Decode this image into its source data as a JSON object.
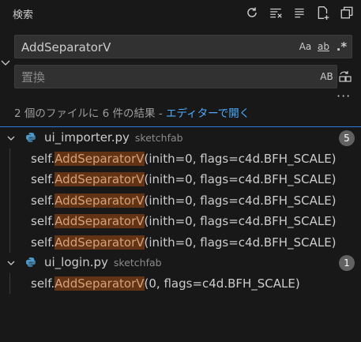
{
  "panel": {
    "title": "検索"
  },
  "header_actions": [
    {
      "name": "refresh-icon"
    },
    {
      "name": "clear-results-icon"
    },
    {
      "name": "collapse-all-icon"
    },
    {
      "name": "new-search-editor-icon"
    },
    {
      "name": "view-as-tree-icon"
    }
  ],
  "search": {
    "value": "AddSeparatorV",
    "options": {
      "match_case": "Aa",
      "whole_word": "ab",
      "regex": ".*"
    }
  },
  "replace": {
    "placeholder": "置換",
    "preserve_case": "AB"
  },
  "summary": {
    "text": "2 個のファイルに 6 件の結果 - ",
    "link": "エディターで開く"
  },
  "results": [
    {
      "file": "ui_importer.py",
      "path": "sketchfab",
      "count": "5",
      "matches": [
        {
          "before": "self.",
          "match": "AddSeparatorV",
          "after": "(inith=0, flags=c4d.BFH_SCALE)"
        },
        {
          "before": "self.",
          "match": "AddSeparatorV",
          "after": "(inith=0, flags=c4d.BFH_SCALE)"
        },
        {
          "before": "self.",
          "match": "AddSeparatorV",
          "after": "(inith=0, flags=c4d.BFH_SCALE)"
        },
        {
          "before": "self.",
          "match": "AddSeparatorV",
          "after": "(inith=0, flags=c4d.BFH_SCALE)"
        },
        {
          "before": "self.",
          "match": "AddSeparatorV",
          "after": "(inith=0, flags=c4d.BFH_SCALE)"
        }
      ]
    },
    {
      "file": "ui_login.py",
      "path": "sketchfab",
      "count": "1",
      "matches": [
        {
          "before": "self.",
          "match": "AddSeparatorV",
          "after": "(0, flags=c4d.BFH_SCALE)"
        }
      ]
    }
  ],
  "colors": {
    "background": "#181818",
    "input_bg": "#313131",
    "highlight_bg": "#623315",
    "highlight_fg": "#d7a077",
    "link": "#4daafc",
    "python_icon": "#4e9acb",
    "divider": "#2b79d8"
  }
}
